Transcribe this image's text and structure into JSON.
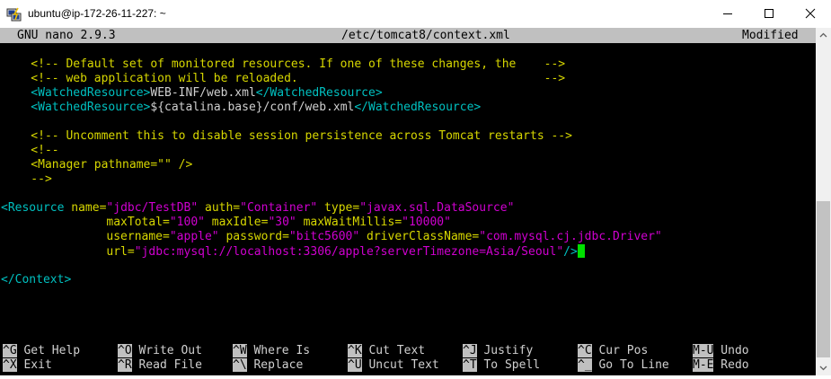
{
  "window": {
    "title": "ubuntu@ip-172-26-11-227: ~"
  },
  "status": {
    "app": "GNU nano 2.9.3",
    "file": "/etc/tomcat8/context.xml",
    "state": "Modified"
  },
  "editor": {
    "l1": "    <!-- Default set of monitored resources. If one of these changes, the    -->",
    "l2": "    <!-- web application will be reloaded.                                   -->",
    "l3_open": "    <WatchedResource>",
    "l3_text": "WEB-INF/web.xml",
    "l3_close": "</WatchedResource>",
    "l4_open": "    <WatchedResource>",
    "l4_text": "${catalina.base}/conf/web.xml",
    "l4_close": "</WatchedResource>",
    "l5": "    <!-- Uncomment this to disable session persistence across Tomcat restarts -->",
    "l6": "    <!--",
    "l7": "    <Manager pathname=\"\" />",
    "l8": "    -->",
    "r1_tag": "<Resource",
    "r1_a1": " name=",
    "r1_v1": "\"jdbc/TestDB\"",
    "r1_a2": " auth=",
    "r1_v2": "\"Container\"",
    "r1_a3": " type=",
    "r1_v3": "\"javax.sql.DataSource\"",
    "r2_a1": "               maxTotal=",
    "r2_v1": "\"100\"",
    "r2_a2": " maxIdle=",
    "r2_v2": "\"30\"",
    "r2_a3": " maxWaitMillis=",
    "r2_v3": "\"10000\"",
    "r3_a1": "               username=",
    "r3_v1": "\"apple\"",
    "r3_a2": " password=",
    "r3_v2": "\"bitc5600\"",
    "r3_a3": " driverClassName=",
    "r3_v3": "\"com.mysql.cj.jdbc.Driver\"",
    "r4_a1": "               url=",
    "r4_v1": "\"jdbc:mysql://localhost:3306/apple?serverTimezone=Asia/Seoul\"",
    "r4_close": "/>",
    "ctx": "</Context>"
  },
  "shortcuts": [
    {
      "key": "^G",
      "label": "Get Help"
    },
    {
      "key": "^O",
      "label": "Write Out"
    },
    {
      "key": "^W",
      "label": "Where Is"
    },
    {
      "key": "^K",
      "label": "Cut Text"
    },
    {
      "key": "^J",
      "label": "Justify"
    },
    {
      "key": "^C",
      "label": "Cur Pos"
    },
    {
      "key": "M-U",
      "label": "Undo"
    },
    {
      "key": "^X",
      "label": "Exit"
    },
    {
      "key": "^R",
      "label": "Read File"
    },
    {
      "key": "^\\",
      "label": "Replace"
    },
    {
      "key": "^U",
      "label": "Uncut Text"
    },
    {
      "key": "^T",
      "label": "To Spell"
    },
    {
      "key": "^_",
      "label": "Go To Line"
    },
    {
      "key": "M-E",
      "label": "Redo"
    }
  ]
}
